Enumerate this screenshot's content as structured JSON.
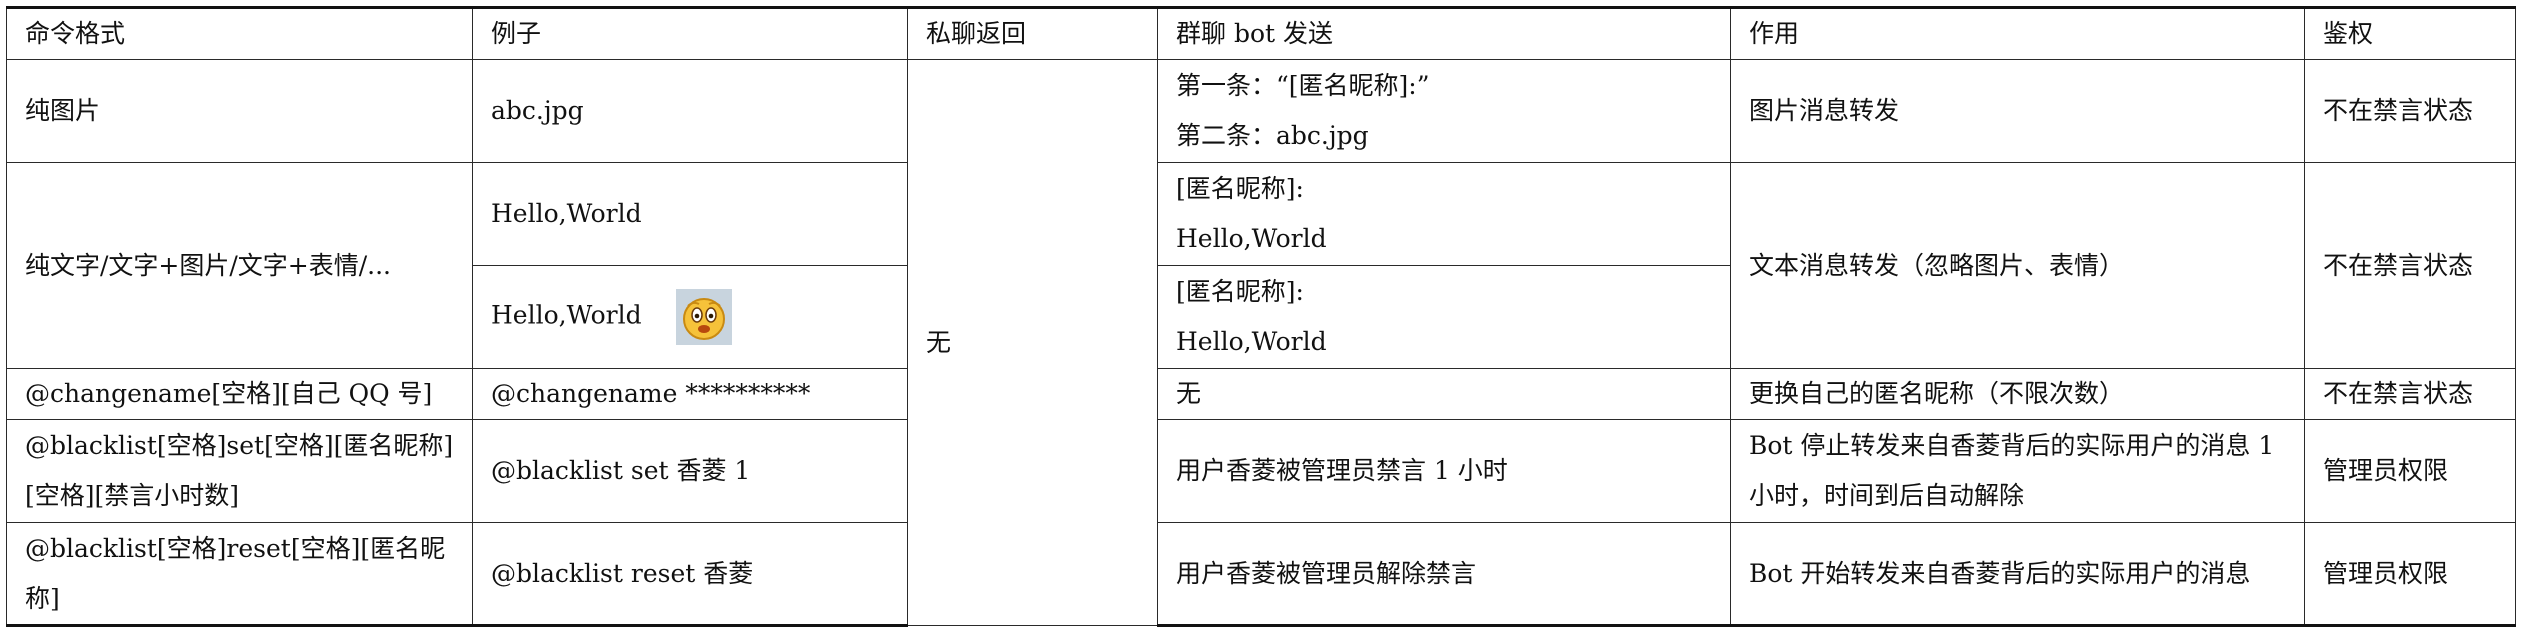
{
  "table": {
    "headers": [
      "命令格式",
      "例子",
      "私聊返回",
      "群聊 bot 发送",
      "作用",
      "鉴权"
    ],
    "private_reply_merged": "无",
    "rows": [
      {
        "format": "纯图片",
        "example": "abc.jpg",
        "group_send_lines": [
          "第一条：“[匿名昵称]:”",
          "第二条：abc.jpg"
        ],
        "effect": "图片消息转发",
        "auth": "不在禁言状态"
      },
      {
        "format": "纯文字/文字+图片/文字+表情/...",
        "sub_rows": [
          {
            "example": "Hello,World",
            "group_send_lines": [
              "[匿名昵称]:",
              "Hello,World"
            ]
          },
          {
            "example": "Hello,World",
            "example_icon": "smiley-emoji-icon",
            "group_send_lines": [
              "[匿名昵称]:",
              "Hello,World"
            ]
          }
        ],
        "effect": "文本消息转发（忽略图片、表情）",
        "auth": "不在禁言状态"
      },
      {
        "format": "@changename[空格][自己 QQ 号]",
        "example": "@changename **********",
        "group_send": "无",
        "effect": "更换自己的匿名昵称（不限次数）",
        "auth": "不在禁言状态"
      },
      {
        "format": "@blacklist[空格]set[空格][匿名昵称][空格][禁言小时数]",
        "example": "@blacklist set  香菱  1",
        "group_send": "用户香菱被管理员禁言 1 小时",
        "effect": "Bot 停止转发来自香菱背后的实际用户的消息 1 小时，时间到后自动解除",
        "auth": "管理员权限"
      },
      {
        "format": "@blacklist[空格]reset[空格][匿名昵称]",
        "example": "@blacklist reset  香菱",
        "group_send": "用户香菱被管理员解除禁言",
        "effect": "Bot 开始转发来自香菱背后的实际用户的消息",
        "auth": "管理员权限"
      }
    ]
  }
}
